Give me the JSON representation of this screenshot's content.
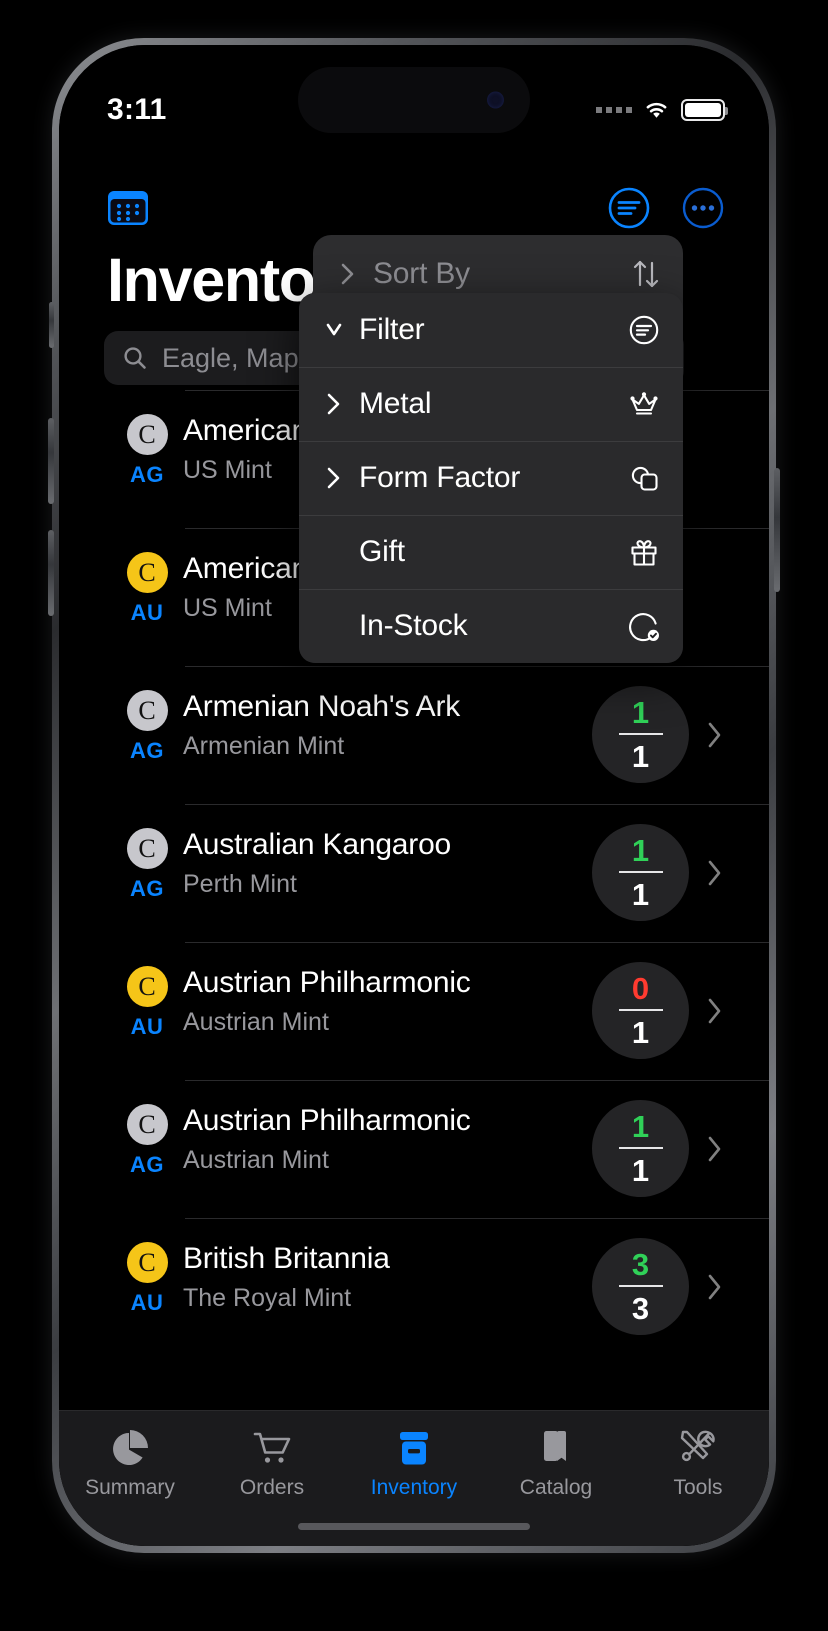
{
  "status_bar": {
    "time": "3:11",
    "signal_icon": "signal-dots-icon",
    "wifi_icon": "wifi-icon",
    "battery_icon": "battery-full-icon"
  },
  "nav_bar": {
    "calendar_button": "calendar-icon",
    "filter_button": "filter-circle-icon",
    "more_button": "ellipsis-circle-icon"
  },
  "header": {
    "title": "Inventory"
  },
  "search": {
    "icon": "search-icon",
    "placeholder": "Eagle, Mapl"
  },
  "context_menu": {
    "sort_by": {
      "label": "Sort By",
      "chevron": "chevron-right-icon",
      "trailing_icon": "arrow-up-arrow-down-icon"
    },
    "items": [
      {
        "label": "Filter",
        "chevron": "chevron-down-icon",
        "icon": "filter-circle-icon",
        "expanded": true
      },
      {
        "label": "Metal",
        "chevron": "chevron-right-icon",
        "icon": "crown-icon",
        "expanded": false
      },
      {
        "label": "Form Factor",
        "chevron": "chevron-right-icon",
        "icon": "shapes-icon",
        "expanded": false
      },
      {
        "label": "Gift",
        "chevron": "",
        "icon": "gift-icon",
        "expanded": false
      },
      {
        "label": "In-Stock",
        "chevron": "",
        "icon": "circle-check-icon",
        "expanded": false
      }
    ]
  },
  "inventory_list": {
    "rows": [
      {
        "badge": "C",
        "metal": "AG",
        "metal_color": "silver",
        "name": "American",
        "mint": "US Mint",
        "qty_have": "",
        "qty_total": "",
        "qty_state": ""
      },
      {
        "badge": "C",
        "metal": "AU",
        "metal_color": "gold",
        "name": "American",
        "mint": "US Mint",
        "qty_have": "",
        "qty_total": "",
        "qty_state": ""
      },
      {
        "badge": "C",
        "metal": "AG",
        "metal_color": "silver",
        "name": "Armenian Noah's Ark",
        "mint": "Armenian Mint",
        "qty_have": "1",
        "qty_total": "1",
        "qty_state": "ok"
      },
      {
        "badge": "C",
        "metal": "AG",
        "metal_color": "silver",
        "name": "Australian Kangaroo",
        "mint": "Perth Mint",
        "qty_have": "1",
        "qty_total": "1",
        "qty_state": "ok"
      },
      {
        "badge": "C",
        "metal": "AU",
        "metal_color": "gold",
        "name": "Austrian Philharmonic",
        "mint": "Austrian Mint",
        "qty_have": "0",
        "qty_total": "1",
        "qty_state": "zero"
      },
      {
        "badge": "C",
        "metal": "AG",
        "metal_color": "silver",
        "name": "Austrian Philharmonic",
        "mint": "Austrian Mint",
        "qty_have": "1",
        "qty_total": "1",
        "qty_state": "ok"
      },
      {
        "badge": "C",
        "metal": "AU",
        "metal_color": "gold",
        "name": "British Britannia",
        "mint": "The Royal Mint",
        "qty_have": "3",
        "qty_total": "3",
        "qty_state": "ok"
      }
    ]
  },
  "tab_bar": {
    "tabs": [
      {
        "label": "Summary",
        "icon": "chart-pie-icon",
        "active": false
      },
      {
        "label": "Orders",
        "icon": "cart-icon",
        "active": false
      },
      {
        "label": "Inventory",
        "icon": "archivebox-icon",
        "active": true
      },
      {
        "label": "Catalog",
        "icon": "book-icon",
        "active": false
      },
      {
        "label": "Tools",
        "icon": "tools-icon",
        "active": false
      }
    ]
  },
  "colors": {
    "accent": "#0a84ff",
    "gold": "#f5c518",
    "silver": "#c7c7cc",
    "in_stock": "#30d158",
    "out_of_stock": "#ff3b30"
  }
}
